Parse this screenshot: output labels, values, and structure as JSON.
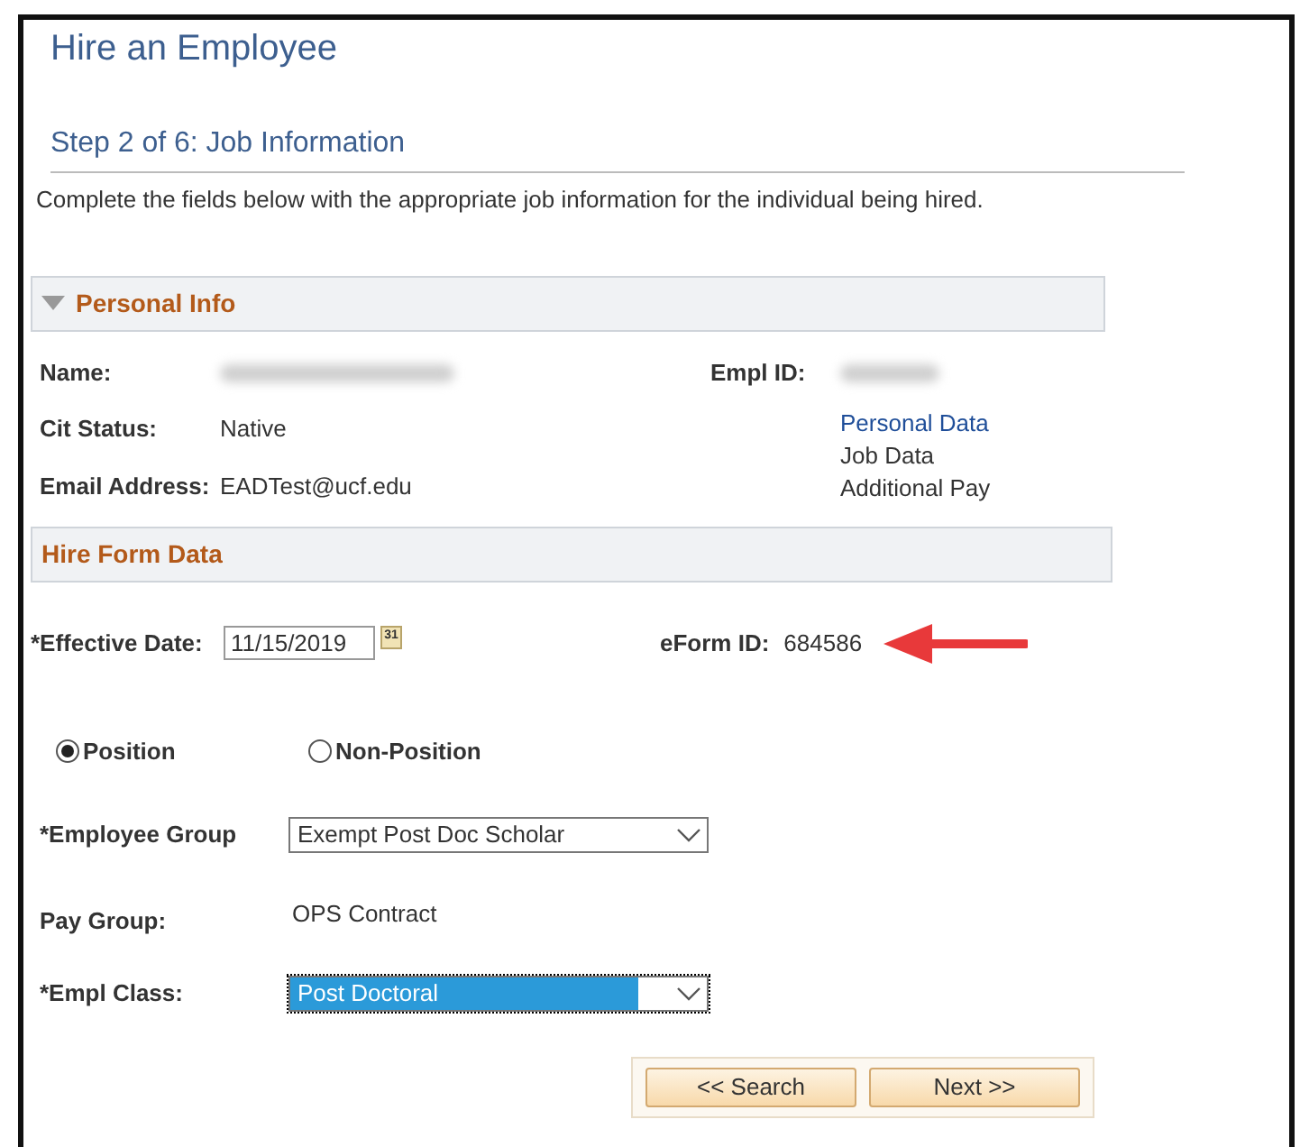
{
  "page": {
    "title": "Hire an Employee",
    "step": "Step 2 of 6: Job Information",
    "instructions": "Complete the fields below with the appropriate job information for the individual being hired."
  },
  "personal_info": {
    "heading": "Personal Info",
    "expanded": true,
    "name": {
      "label": "Name:",
      "redacted": true
    },
    "empl_id": {
      "label": "Empl ID:",
      "redacted": true
    },
    "cit_status": {
      "label": "Cit Status:",
      "value": "Native"
    },
    "email": {
      "label": "Email Address:",
      "value": "EADTest@ucf.edu"
    },
    "links": [
      {
        "text": "Personal Data",
        "kind": "link"
      },
      {
        "text": "Job Data",
        "kind": "plain"
      },
      {
        "text": "Additional Pay",
        "kind": "plain"
      }
    ]
  },
  "hire_form": {
    "heading": "Hire Form Data",
    "effective_date": {
      "label": "*Effective Date:",
      "value": "11/15/2019",
      "calendar_glyph": "31"
    },
    "eform_id": {
      "label": "eForm ID:",
      "value": "684586"
    },
    "position_options": [
      {
        "label": "Position",
        "selected": true
      },
      {
        "label": "Non-Position",
        "selected": false
      }
    ],
    "employee_group": {
      "label": "*Employee Group",
      "value": "Exempt Post Doc Scholar",
      "focused": false
    },
    "pay_group": {
      "label": "Pay Group:",
      "value": "OPS Contract"
    },
    "empl_class": {
      "label": "*Empl Class:",
      "value": "Post Doctoral",
      "focused": true
    }
  },
  "buttons": [
    {
      "label": "<< Search"
    },
    {
      "label": "Next >>"
    }
  ]
}
